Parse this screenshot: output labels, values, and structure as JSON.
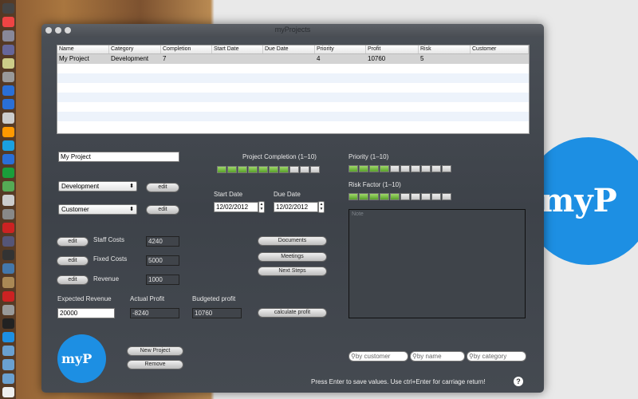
{
  "window": {
    "title": "myProjects"
  },
  "brand": {
    "text": "myP"
  },
  "table": {
    "headers": [
      "Name",
      "Category",
      "Completion",
      "Start Date",
      "Due Date",
      "Priority",
      "Profit",
      "Risk",
      "Customer"
    ],
    "rows": [
      [
        "My Project",
        "Development",
        "7",
        "",
        "",
        "4",
        "10760",
        "5",
        ""
      ]
    ]
  },
  "form": {
    "name": "My Project",
    "category": "Development",
    "customer": "Customer",
    "edit_label": "edit",
    "completion_label": "Project Completion (1–10)",
    "completion_value": 7,
    "priority_label": "Priority (1–10)",
    "priority_value": 4,
    "risk_label": "Risk Factor (1–10)",
    "risk_value": 5,
    "start_label": "Start Date",
    "start_value": "12/02/2012",
    "due_label": "Due Date",
    "due_value": "12/02/2012",
    "staff_label": "Staff Costs",
    "staff_value": "4240",
    "fixed_label": "Fixed Costs",
    "fixed_value": "5000",
    "revenue_label": "Revenue",
    "revenue_value": "1000",
    "expected_label": "Expected Revenue",
    "expected_value": "20000",
    "actual_label": "Actual Profit",
    "actual_value": "-8240",
    "budget_label": "Budgeted profit",
    "budget_value": "10760",
    "notes_placeholder": "Note"
  },
  "buttons": {
    "documents": "Documents",
    "meetings": "Meetings",
    "next_steps": "Next Steps",
    "calculate": "calculate profit",
    "new_project": "New Project",
    "remove": "Remove"
  },
  "search": {
    "customer": "by customer",
    "name": "by name",
    "category": "by category"
  },
  "footer": "Press Enter to save values. Use ctrl+Enter for carriage return!",
  "help": "?",
  "colors": {
    "accent": "#1d8fe3",
    "bar_on": "#6fb83a"
  }
}
